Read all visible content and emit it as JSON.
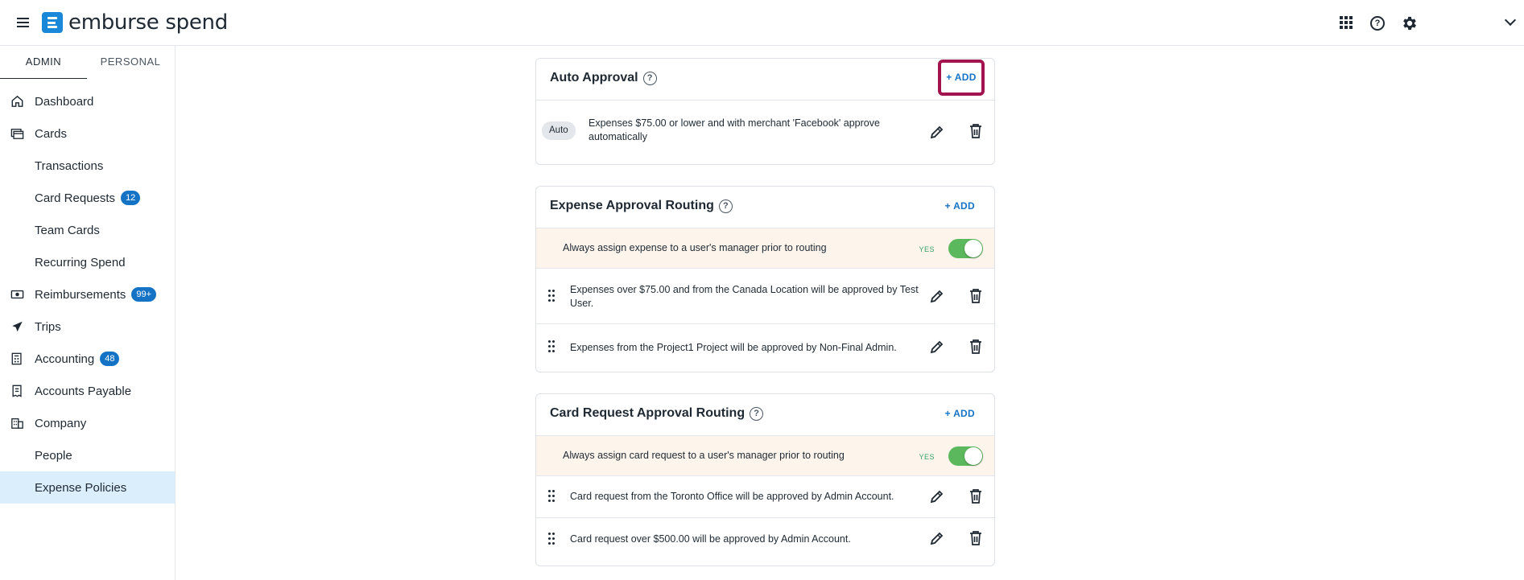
{
  "header": {
    "logo_text": "emburse spend",
    "icons": [
      "apps-grid-icon",
      "help-icon",
      "settings-gear-icon",
      "chevron-down-icon"
    ]
  },
  "sidebar": {
    "tabs": [
      {
        "label": "ADMIN",
        "active": true
      },
      {
        "label": "PERSONAL",
        "active": false
      }
    ],
    "items": [
      {
        "label": "Dashboard",
        "icon": "home-icon"
      },
      {
        "label": "Cards",
        "icon": "cards-icon"
      },
      {
        "label": "Transactions"
      },
      {
        "label": "Card Requests",
        "badge": "12"
      },
      {
        "label": "Team Cards"
      },
      {
        "label": "Recurring Spend"
      },
      {
        "label": "Reimbursements",
        "badge": "99+",
        "icon": "money-icon"
      },
      {
        "label": "Trips",
        "icon": "plane-icon"
      },
      {
        "label": "Accounting",
        "badge": "48",
        "icon": "accounting-icon"
      },
      {
        "label": "Accounts Payable",
        "icon": "receipt-icon"
      },
      {
        "label": "Company",
        "icon": "building-icon"
      },
      {
        "label": "People"
      },
      {
        "label": "Expense Policies",
        "active": true
      }
    ]
  },
  "auto_approval": {
    "title": "Auto Approval",
    "add_label": "+ ADD",
    "rule": {
      "pill": "Auto",
      "text": "Expenses $75.00 or lower and with merchant 'Facebook' approve automatically"
    }
  },
  "expense_routing": {
    "title": "Expense Approval Routing",
    "add_label": "+ ADD",
    "manager_text": "Always assign expense to a user's manager prior to routing",
    "toggle_label": "YES",
    "rules": [
      "Expenses over $75.00 and from the Canada Location will be approved by Test User.",
      "Expenses from the Project1 Project will be approved by Non-Final Admin."
    ]
  },
  "card_routing": {
    "title": "Card Request Approval Routing",
    "add_label": "+ ADD",
    "manager_text": "Always assign card request to a user's manager prior to routing",
    "toggle_label": "YES",
    "rules": [
      "Card request from the Toronto Office will be approved by Admin Account.",
      "Card request over $500.00 will be approved by Admin Account."
    ]
  },
  "colors": {
    "accent": "#1573c6",
    "active_nav": "#dbeefb",
    "toggle_on": "#5cb85c",
    "highlight": "#a3134e",
    "manager_row_bg": "#fdf5ec"
  }
}
